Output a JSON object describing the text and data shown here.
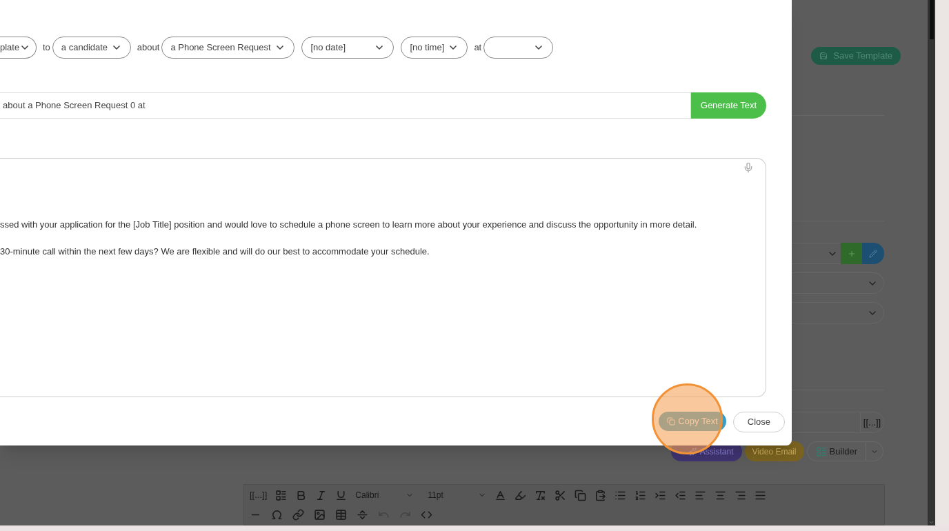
{
  "modal": {
    "phrase": [
      {
        "kind": "select",
        "value": "plate"
      },
      {
        "kind": "word",
        "text": "to"
      },
      {
        "kind": "select",
        "value": "a candidate"
      },
      {
        "kind": "word",
        "text": "about"
      },
      {
        "kind": "select",
        "value": "a Phone Screen Request"
      },
      {
        "kind": "select",
        "value": "[no date]"
      },
      {
        "kind": "select",
        "value": "[no time]"
      },
      {
        "kind": "word",
        "text": "at"
      },
      {
        "kind": "select"
      }
    ],
    "prompt": {
      "value": "about a Phone Screen Request 0 at"
    },
    "generate_button": "Generate Text",
    "message_lines": [
      "ssed with your application for the [Job Title] position and would love to schedule a phone screen to learn more about your experience and discuss the opportunity in more detail.",
      "30-minute call within the next few days? We are flexible and will do our best to accommodate your schedule."
    ],
    "buttons": [
      "Copy Text",
      "Close"
    ]
  },
  "page": {
    "save_button": "Save Template",
    "tag_button": "[[...]]",
    "action_buttons": [
      {
        "kind": "ai",
        "label": "Assistant"
      },
      {
        "kind": "video",
        "label": "Video Email"
      },
      {
        "kind": "builder",
        "label": "Builder"
      }
    ]
  },
  "toolbar": {
    "tag_button": "[[...]]",
    "font": "Calibri",
    "size": "11pt",
    "history_buttons": [
      {
        "disabled": true
      },
      {
        "disabled": true
      }
    ]
  }
}
